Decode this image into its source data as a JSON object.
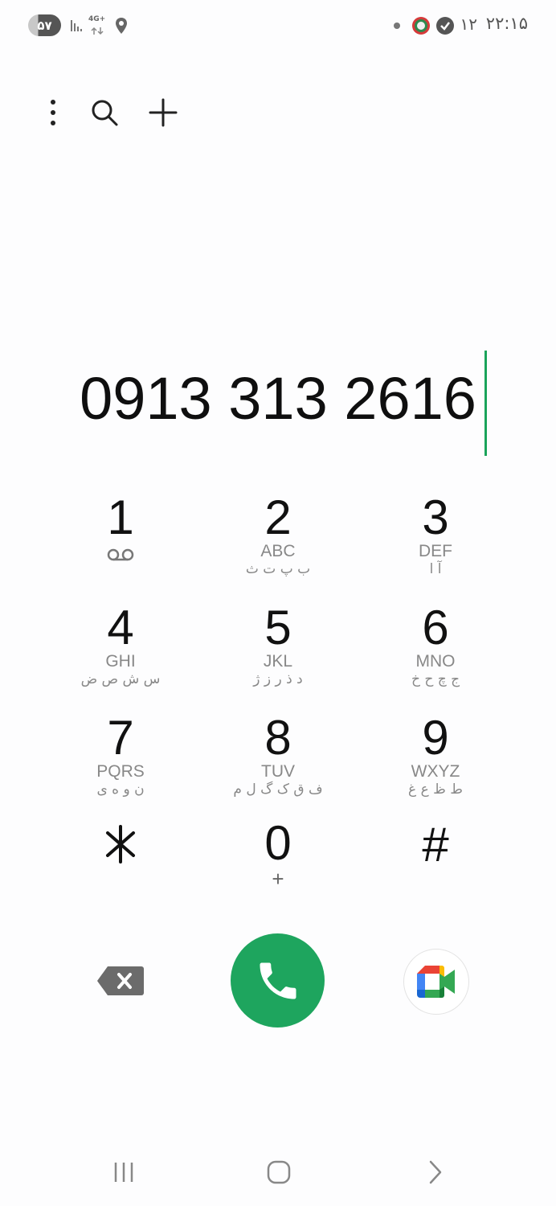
{
  "status_bar": {
    "battery": "۵۷",
    "network": "4G+",
    "date": "۱۲",
    "time": "۲۲:۱۵"
  },
  "toolbar": {
    "icons": [
      "more-vert-icon",
      "search-icon",
      "add-icon"
    ]
  },
  "dialer": {
    "number": "0913 313 2616",
    "keys": [
      {
        "digit": "1",
        "latin": "",
        "farsi": "",
        "sub_icon": "voicemail-icon"
      },
      {
        "digit": "2",
        "latin": "ABC",
        "farsi": "ب پ ت ث"
      },
      {
        "digit": "3",
        "latin": "DEF",
        "farsi": "آ ا"
      },
      {
        "digit": "4",
        "latin": "GHI",
        "farsi": "س ش ص ض"
      },
      {
        "digit": "5",
        "latin": "JKL",
        "farsi": "د ذ ر ز ژ"
      },
      {
        "digit": "6",
        "latin": "MNO",
        "farsi": "ج چ ح خ"
      },
      {
        "digit": "7",
        "latin": "PQRS",
        "farsi": "ن و ه ی"
      },
      {
        "digit": "8",
        "latin": "TUV",
        "farsi": "ف ق ک گ ل م"
      },
      {
        "digit": "9",
        "latin": "WXYZ",
        "farsi": "ط ظ ع غ"
      },
      {
        "digit": "⁎",
        "latin": "",
        "farsi": ""
      },
      {
        "digit": "0",
        "latin": "",
        "farsi": "",
        "sub": "+"
      },
      {
        "digit": "#",
        "latin": "",
        "farsi": ""
      }
    ]
  },
  "actions": {
    "backspace_icon": "backspace-icon",
    "call_icon": "phone-icon",
    "video_icon": "google-meet-icon",
    "colors": {
      "call": "#1ea55e",
      "cursor": "#1aa35a"
    }
  },
  "nav_bar": {
    "icons": [
      "recents-icon",
      "home-icon",
      "back-icon"
    ]
  }
}
